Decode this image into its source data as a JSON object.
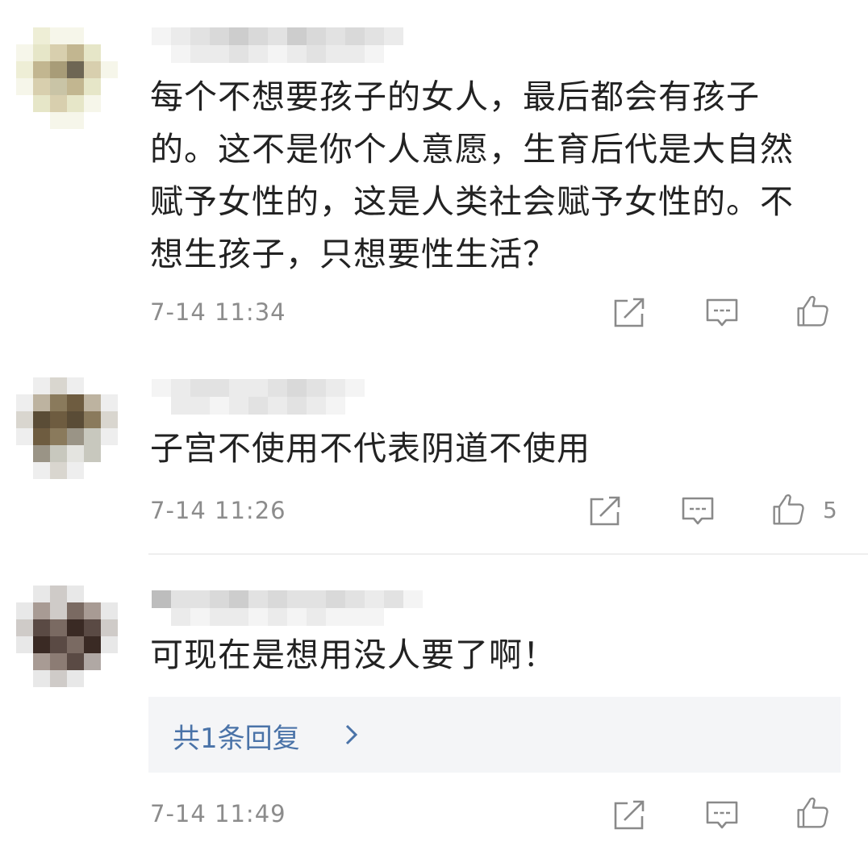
{
  "comments": [
    {
      "text_lines": [
        "每个不想要孩子的女人，最后都会有孩子",
        "的。这不是你个人意愿，生育后代是大自然",
        "赋予女性的，这是人类社会赋予女性的。不",
        "想生孩子，只想要性生活？"
      ],
      "time": "7-14 11:34",
      "like_count": ""
    },
    {
      "text_lines": [
        "子宫不使用不代表阴道不使用"
      ],
      "time": "7-14 11:26",
      "like_count": "5"
    },
    {
      "text_lines": [
        "可现在是想用没人要了啊！"
      ],
      "time": "7-14 11:49",
      "like_count": "",
      "reply_link": "共1条回复",
      "reply_chevron": "chevron-right-icon"
    }
  ],
  "icons": {
    "share": "share-icon",
    "reply": "comment-icon",
    "like": "thumbs-up-icon"
  },
  "colors": {
    "text": "#222222",
    "meta": "#8c8c8c",
    "link": "#4a73a8",
    "reply_bg": "#f4f5f7",
    "icon": "#8a8a8a"
  }
}
